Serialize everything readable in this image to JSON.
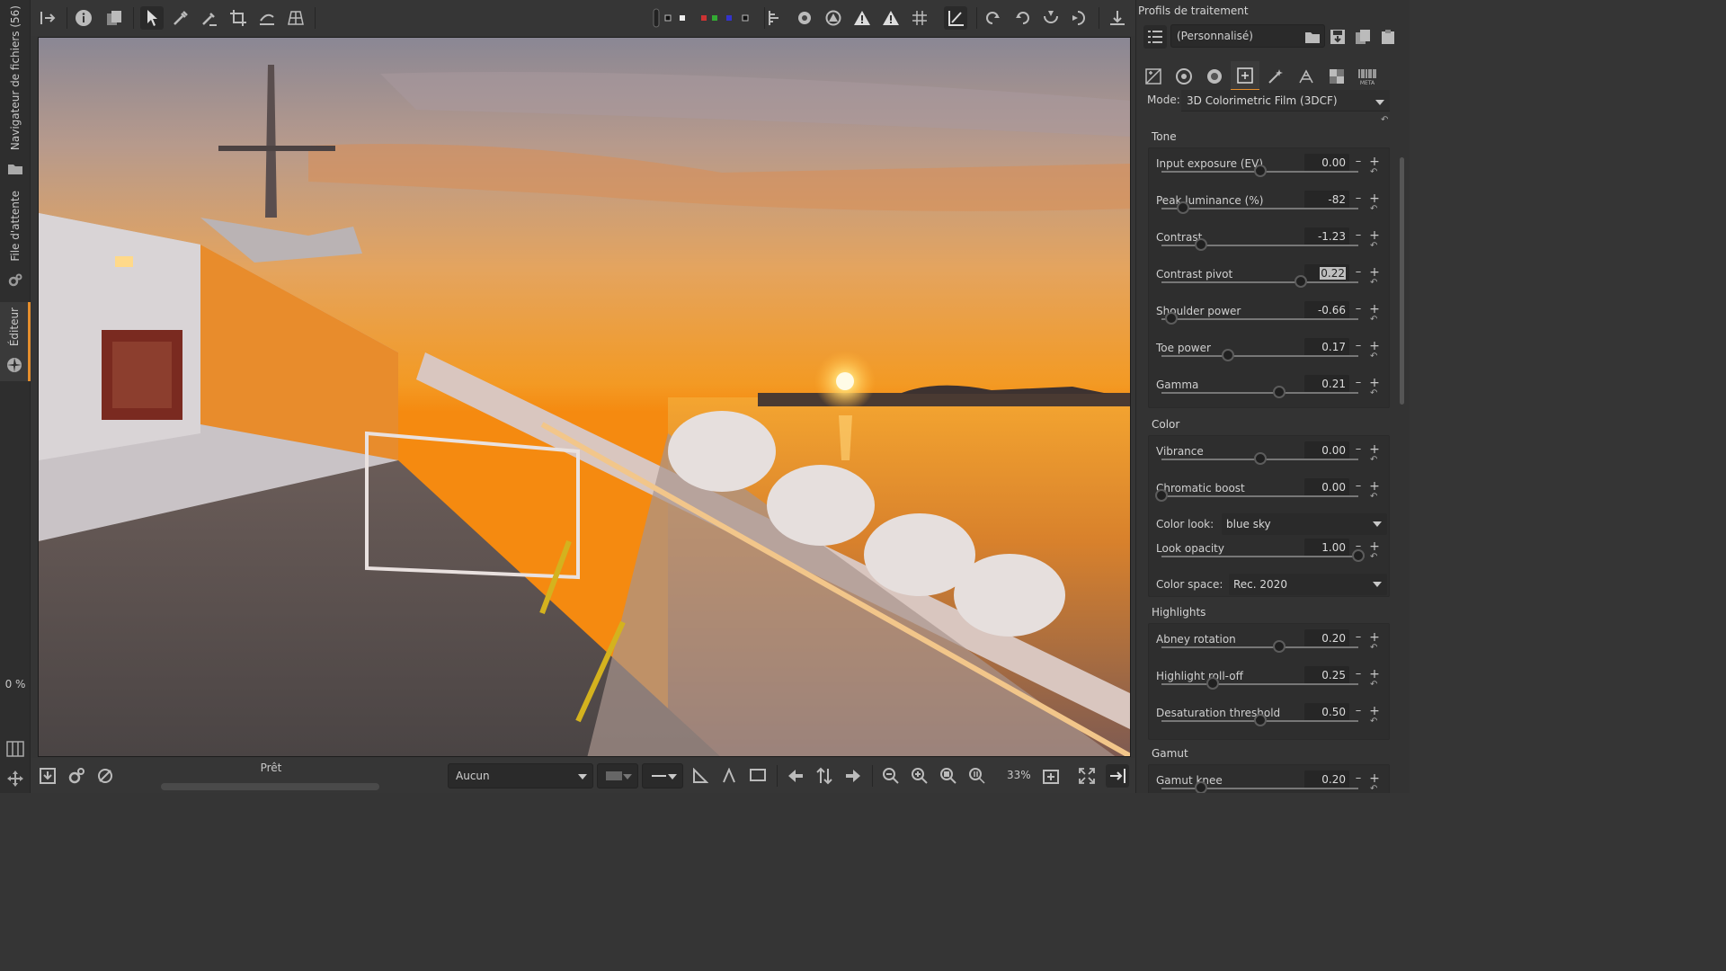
{
  "left_tabs": {
    "file_browser": "Navigateur de fichiers (56)",
    "queue": "File d'attente",
    "editor": "Éditeur",
    "progress_percent": "0 %"
  },
  "top_toolbar": {
    "active_tool": "hand-tool"
  },
  "bottom_bar": {
    "status": "Prêt",
    "preview_profile": "Aucun",
    "zoom": "33%"
  },
  "processing_profiles": {
    "title": "Profils de traitement",
    "current": "(Personnalisé)"
  },
  "tool_tabs": [
    "exposure",
    "detail",
    "color",
    "transform-selected",
    "raw",
    "advanced-filmic",
    "wavelet",
    "meta"
  ],
  "tone_mapper": {
    "mode_label": "Mode:",
    "mode_value": "3D Colorimetric Film (3DCF)",
    "sections": {
      "tone": "Tone",
      "color": "Color",
      "highlights": "Highlights",
      "gamut": "Gamut"
    },
    "tone_controls": [
      {
        "label": "Input exposure (EV)",
        "value": "0.00",
        "level": 0.5
      },
      {
        "label": "Peak luminance (%)",
        "value": "-82",
        "level": 0.11
      },
      {
        "label": "Contrast",
        "value": "-1.23",
        "level": 0.2
      },
      {
        "label": "Contrast pivot",
        "value": "0.22",
        "level": 0.71,
        "focused": true
      },
      {
        "label": "Shoulder power",
        "value": "-0.66",
        "level": 0.05
      },
      {
        "label": "Toe power",
        "value": "0.17",
        "level": 0.34
      },
      {
        "label": "Gamma",
        "value": "0.21",
        "level": 0.6
      }
    ],
    "color_controls": [
      {
        "label": "Vibrance",
        "value": "0.00",
        "level": 0.5
      },
      {
        "label": "Chromatic boost",
        "value": "0.00",
        "level": 0.0
      }
    ],
    "color_look_label": "Color look:",
    "color_look_value": "blue sky",
    "look_opacity": {
      "label": "Look opacity",
      "value": "1.00",
      "level": 1.0
    },
    "color_space_label": "Color space:",
    "color_space_value": "Rec. 2020",
    "highlight_controls": [
      {
        "label": "Abney rotation",
        "value": "0.20",
        "level": 0.6
      },
      {
        "label": "Highlight roll-off",
        "value": "0.25",
        "level": 0.26
      },
      {
        "label": "Desaturation threshold",
        "value": "0.50",
        "level": 0.5
      }
    ],
    "gamut_controls": [
      {
        "label": "Gamut knee",
        "value": "0.20",
        "level": 0.2
      }
    ]
  },
  "colors": {
    "accent": "#e58e2c",
    "panel": "#333333",
    "toolbar": "#363636"
  }
}
